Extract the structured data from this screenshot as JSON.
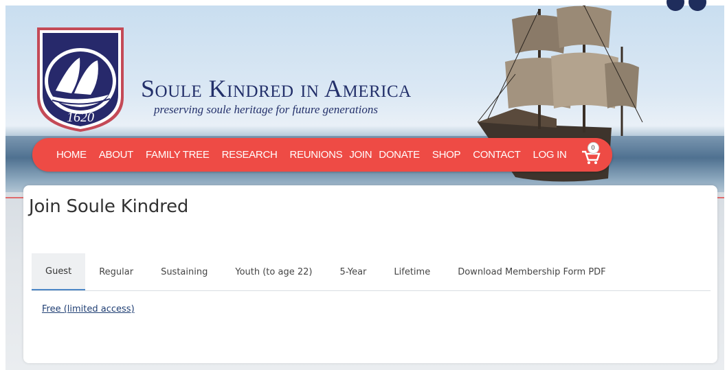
{
  "header": {
    "logo_year": "1620",
    "title": "Soule Kindred in America",
    "tagline": "preserving soule heritage for future generations"
  },
  "nav": {
    "items": [
      "HOME",
      "ABOUT",
      "FAMILY TREE",
      "RESEARCH",
      "REUNIONS",
      "JOIN",
      "DONATE",
      "SHOP",
      "CONTACT",
      "LOG IN"
    ],
    "cart_count": "0"
  },
  "main": {
    "title": "Join Soule Kindred",
    "tabs": [
      {
        "label": "Guest",
        "active": true
      },
      {
        "label": "Regular",
        "active": false
      },
      {
        "label": "Sustaining",
        "active": false
      },
      {
        "label": "Youth (to age 22)",
        "active": false
      },
      {
        "label": "5-Year",
        "active": false
      },
      {
        "label": "Lifetime",
        "active": false
      },
      {
        "label": "Download Membership Form PDF",
        "active": false
      }
    ],
    "tab_content_link": "Free (limited access)"
  },
  "colors": {
    "nav_bg": "#ee4b45",
    "brand_navy": "#23306a",
    "active_tab_underline": "#4c87c7"
  }
}
